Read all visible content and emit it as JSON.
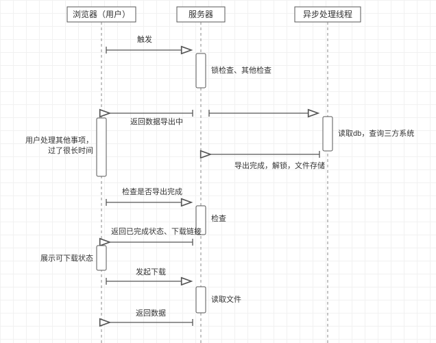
{
  "diagram": {
    "lanes": {
      "browser": "浏览器（用户）",
      "server": "服务器",
      "async": "异步处理线程"
    },
    "messages": {
      "trigger": "触发",
      "lockCheck": "锁检查、其他检查",
      "returnExporting": "返回数据导出中",
      "readDb": "读取db，查询三方系统",
      "exportDone": "导出完成，解锁，文件存储",
      "checkDone": "检查是否导出完成",
      "check": "检查",
      "returnDone": "返回已完成状态、下载链接",
      "download": "发起下载",
      "readFile": "读取文件",
      "returnData": "返回数据"
    },
    "notes": {
      "userBusy": "用户处理其他事项，\n过了很长时间",
      "showDownload": "展示可下载状态"
    }
  },
  "chart_data": {
    "type": "sequence",
    "participants": [
      "浏览器（用户）",
      "服务器",
      "异步处理线程"
    ],
    "steps": [
      {
        "from": "浏览器（用户）",
        "to": "服务器",
        "label": "触发"
      },
      {
        "at": "服务器",
        "self": true,
        "label": "锁检查、其他检查"
      },
      {
        "from": "服务器",
        "to": "浏览器（用户）",
        "label": "返回数据导出中"
      },
      {
        "from": "服务器",
        "to": "异步处理线程",
        "label": ""
      },
      {
        "at": "异步处理线程",
        "self": true,
        "label": "读取db，查询三方系统"
      },
      {
        "at": "浏览器（用户）",
        "note": true,
        "label": "用户处理其他事项，过了很长时间"
      },
      {
        "from": "异步处理线程",
        "to": "服务器",
        "label": "导出完成，解锁，文件存储"
      },
      {
        "from": "浏览器（用户）",
        "to": "服务器",
        "label": "检查是否导出完成"
      },
      {
        "at": "服务器",
        "self": true,
        "label": "检查"
      },
      {
        "from": "服务器",
        "to": "浏览器（用户）",
        "label": "返回已完成状态、下载链接"
      },
      {
        "at": "浏览器（用户）",
        "note": true,
        "label": "展示可下载状态"
      },
      {
        "from": "浏览器（用户）",
        "to": "服务器",
        "label": "发起下载"
      },
      {
        "at": "服务器",
        "self": true,
        "label": "读取文件"
      },
      {
        "from": "服务器",
        "to": "浏览器（用户）",
        "label": "返回数据"
      }
    ]
  }
}
